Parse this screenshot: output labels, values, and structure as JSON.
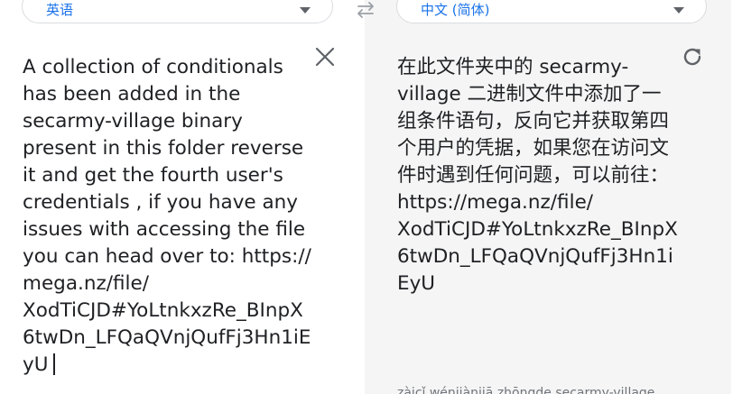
{
  "source_language": {
    "label": "英语"
  },
  "target_language": {
    "label": "中文 (简体)"
  },
  "icons": {
    "swap": "swap-languages-icon",
    "clear": "close-icon",
    "refresh": "refresh-icon",
    "dropdown": "chevron-down-icon"
  },
  "source": {
    "lines": [
      "A collection of conditionals",
      "has been added in the",
      "secarmy-village binary",
      "present in this folder reverse",
      "it and get the fourth user's",
      "credentials , if you have any",
      "issues with accessing the file",
      "you can head over to: https://",
      "mega.nz/file/",
      "XodTiCJD#YoLtnkxzRe_BInpX",
      "6twDn_LFQaQVnjQufFj3Hn1iE",
      "yU"
    ]
  },
  "translation": {
    "lines": [
      "在此文件夹中的 secarmy-",
      "village 二进制文件中添加了一",
      "组条件语句，反向它并获取第四",
      "个用户的凭据，如果您在访问文",
      "件时遇到任何问题，可以前往：",
      "https://mega.nz/file/",
      "XodTiCJD#YoLtnkxzRe_BInpX",
      "6twDn_LFQaQVnjQufFj3Hn1i",
      "EyU"
    ],
    "romanization": "zàicǐ wénjiànjiā zhōngde secarmy-village"
  },
  "colors": {
    "accent": "#1a73e8",
    "icon": "#5f6368",
    "text": "#202124",
    "output_bg": "#f5f5f5"
  }
}
